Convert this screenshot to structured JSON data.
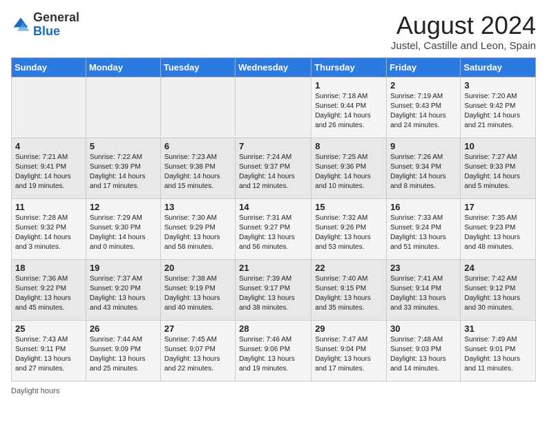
{
  "header": {
    "logo_general": "General",
    "logo_blue": "Blue",
    "month_year": "August 2024",
    "location": "Justel, Castille and Leon, Spain"
  },
  "days_of_week": [
    "Sunday",
    "Monday",
    "Tuesday",
    "Wednesday",
    "Thursday",
    "Friday",
    "Saturday"
  ],
  "weeks": [
    [
      {
        "day": "",
        "content": ""
      },
      {
        "day": "",
        "content": ""
      },
      {
        "day": "",
        "content": ""
      },
      {
        "day": "",
        "content": ""
      },
      {
        "day": "1",
        "content": "Sunrise: 7:18 AM\nSunset: 9:44 PM\nDaylight: 14 hours and 26 minutes."
      },
      {
        "day": "2",
        "content": "Sunrise: 7:19 AM\nSunset: 9:43 PM\nDaylight: 14 hours and 24 minutes."
      },
      {
        "day": "3",
        "content": "Sunrise: 7:20 AM\nSunset: 9:42 PM\nDaylight: 14 hours and 21 minutes."
      }
    ],
    [
      {
        "day": "4",
        "content": "Sunrise: 7:21 AM\nSunset: 9:41 PM\nDaylight: 14 hours and 19 minutes."
      },
      {
        "day": "5",
        "content": "Sunrise: 7:22 AM\nSunset: 9:39 PM\nDaylight: 14 hours and 17 minutes."
      },
      {
        "day": "6",
        "content": "Sunrise: 7:23 AM\nSunset: 9:38 PM\nDaylight: 14 hours and 15 minutes."
      },
      {
        "day": "7",
        "content": "Sunrise: 7:24 AM\nSunset: 9:37 PM\nDaylight: 14 hours and 12 minutes."
      },
      {
        "day": "8",
        "content": "Sunrise: 7:25 AM\nSunset: 9:36 PM\nDaylight: 14 hours and 10 minutes."
      },
      {
        "day": "9",
        "content": "Sunrise: 7:26 AM\nSunset: 9:34 PM\nDaylight: 14 hours and 8 minutes."
      },
      {
        "day": "10",
        "content": "Sunrise: 7:27 AM\nSunset: 9:33 PM\nDaylight: 14 hours and 5 minutes."
      }
    ],
    [
      {
        "day": "11",
        "content": "Sunrise: 7:28 AM\nSunset: 9:32 PM\nDaylight: 14 hours and 3 minutes."
      },
      {
        "day": "12",
        "content": "Sunrise: 7:29 AM\nSunset: 9:30 PM\nDaylight: 14 hours and 0 minutes."
      },
      {
        "day": "13",
        "content": "Sunrise: 7:30 AM\nSunset: 9:29 PM\nDaylight: 13 hours and 58 minutes."
      },
      {
        "day": "14",
        "content": "Sunrise: 7:31 AM\nSunset: 9:27 PM\nDaylight: 13 hours and 56 minutes."
      },
      {
        "day": "15",
        "content": "Sunrise: 7:32 AM\nSunset: 9:26 PM\nDaylight: 13 hours and 53 minutes."
      },
      {
        "day": "16",
        "content": "Sunrise: 7:33 AM\nSunset: 9:24 PM\nDaylight: 13 hours and 51 minutes."
      },
      {
        "day": "17",
        "content": "Sunrise: 7:35 AM\nSunset: 9:23 PM\nDaylight: 13 hours and 48 minutes."
      }
    ],
    [
      {
        "day": "18",
        "content": "Sunrise: 7:36 AM\nSunset: 9:22 PM\nDaylight: 13 hours and 45 minutes."
      },
      {
        "day": "19",
        "content": "Sunrise: 7:37 AM\nSunset: 9:20 PM\nDaylight: 13 hours and 43 minutes."
      },
      {
        "day": "20",
        "content": "Sunrise: 7:38 AM\nSunset: 9:19 PM\nDaylight: 13 hours and 40 minutes."
      },
      {
        "day": "21",
        "content": "Sunrise: 7:39 AM\nSunset: 9:17 PM\nDaylight: 13 hours and 38 minutes."
      },
      {
        "day": "22",
        "content": "Sunrise: 7:40 AM\nSunset: 9:15 PM\nDaylight: 13 hours and 35 minutes."
      },
      {
        "day": "23",
        "content": "Sunrise: 7:41 AM\nSunset: 9:14 PM\nDaylight: 13 hours and 33 minutes."
      },
      {
        "day": "24",
        "content": "Sunrise: 7:42 AM\nSunset: 9:12 PM\nDaylight: 13 hours and 30 minutes."
      }
    ],
    [
      {
        "day": "25",
        "content": "Sunrise: 7:43 AM\nSunset: 9:11 PM\nDaylight: 13 hours and 27 minutes."
      },
      {
        "day": "26",
        "content": "Sunrise: 7:44 AM\nSunset: 9:09 PM\nDaylight: 13 hours and 25 minutes."
      },
      {
        "day": "27",
        "content": "Sunrise: 7:45 AM\nSunset: 9:07 PM\nDaylight: 13 hours and 22 minutes."
      },
      {
        "day": "28",
        "content": "Sunrise: 7:46 AM\nSunset: 9:06 PM\nDaylight: 13 hours and 19 minutes."
      },
      {
        "day": "29",
        "content": "Sunrise: 7:47 AM\nSunset: 9:04 PM\nDaylight: 13 hours and 17 minutes."
      },
      {
        "day": "30",
        "content": "Sunrise: 7:48 AM\nSunset: 9:03 PM\nDaylight: 13 hours and 14 minutes."
      },
      {
        "day": "31",
        "content": "Sunrise: 7:49 AM\nSunset: 9:01 PM\nDaylight: 13 hours and 11 minutes."
      }
    ]
  ],
  "footer": {
    "daylight_label": "Daylight hours"
  }
}
